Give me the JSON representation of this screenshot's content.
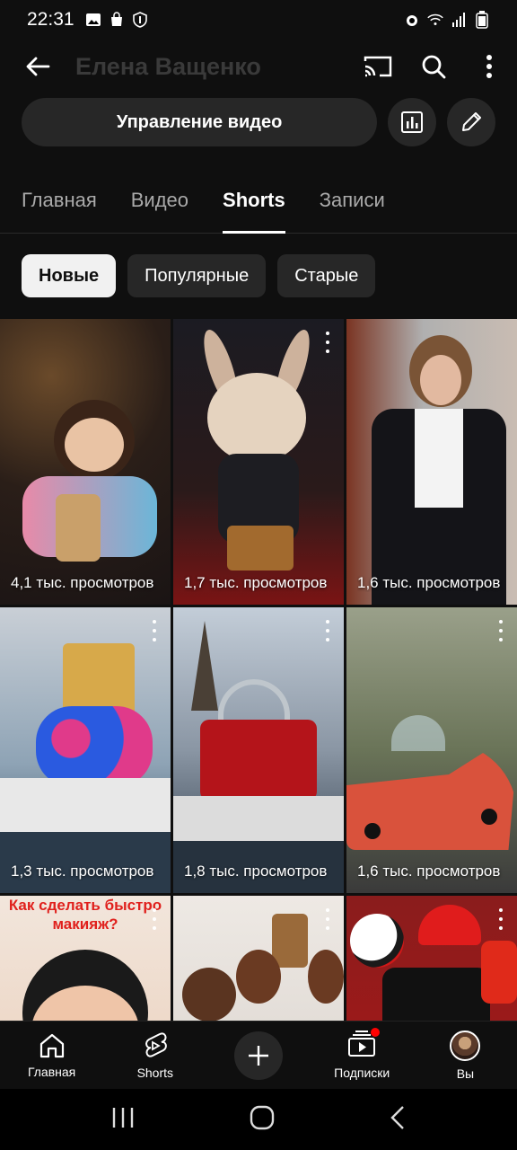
{
  "status_bar": {
    "time": "22:31",
    "icons_left": [
      "image-icon",
      "bag-icon",
      "shield-badge-icon"
    ],
    "icons_right": [
      "alarm-icon",
      "wifi-icon",
      "signal-icon",
      "battery-icon"
    ]
  },
  "header": {
    "channel_name": "Елена Ващенко",
    "icons": [
      "back-arrow-icon",
      "cast-icon",
      "search-icon",
      "more-vert-icon"
    ]
  },
  "manage": {
    "label": "Управление видео"
  },
  "tabs": [
    {
      "label": "Главная",
      "active": false
    },
    {
      "label": "Видео",
      "active": false
    },
    {
      "label": "Shorts",
      "active": true
    },
    {
      "label": "Записи",
      "active": false
    }
  ],
  "chips": [
    {
      "label": "Новые",
      "selected": true
    },
    {
      "label": "Популярные",
      "selected": false
    },
    {
      "label": "Старые",
      "selected": false
    }
  ],
  "shorts": [
    {
      "views": "4,1 тыс. просмотров",
      "subject": "monkey with bubble tea"
    },
    {
      "views": "1,7 тыс. просмотров",
      "subject": "creature with handbag"
    },
    {
      "views": "1,6 тыс. просмотров",
      "subject": "woman in black suit"
    },
    {
      "views": "1,3 тыс. просмотров",
      "subject": "perfume bottle boat"
    },
    {
      "views": "1,8 тыс. просмотров",
      "subject": "red bag boat"
    },
    {
      "views": "1,6 тыс. просмотров",
      "subject": "shoe car"
    },
    {
      "views": "",
      "caption": "Как сделать быстро макияж?",
      "subject": "makeup"
    },
    {
      "views": "",
      "subject": "dolls"
    },
    {
      "views": "",
      "subject": "sports gear"
    }
  ],
  "bottom_nav": [
    {
      "label": "Главная",
      "icon": "home-icon"
    },
    {
      "label": "Shorts",
      "icon": "shorts-icon"
    },
    {
      "label": "",
      "icon": "plus-icon"
    },
    {
      "label": "Подписки",
      "icon": "subscriptions-icon"
    },
    {
      "label": "Вы",
      "icon": "avatar-icon"
    }
  ],
  "colors": {
    "background": "#0f0f0f",
    "surface": "#272727",
    "accent_red": "#ff0000"
  }
}
